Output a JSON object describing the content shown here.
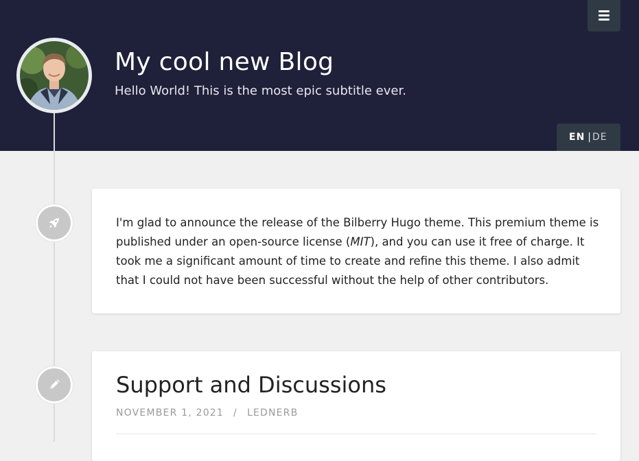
{
  "header": {
    "title": "My cool new Blog",
    "subtitle": "Hello World! This is the most epic subtitle ever.",
    "menu_icon": "hamburger-menu-icon",
    "background_color": "#1f2039"
  },
  "language_switch": {
    "current": "EN",
    "separator": "|",
    "other": "DE"
  },
  "posts": [
    {
      "icon": "rocket-icon",
      "text_before": "I'm glad to announce the release of the Bilberry Hugo theme. This premium theme is published under an open-source license (",
      "text_emphasis": "MIT",
      "text_after": "), and you can use it free of charge. It took me a significant amount of time to create and refine this theme. I also admit that I could not have been successful without the help of other contributors."
    },
    {
      "icon": "pencil-icon",
      "title": "Support and Discussions",
      "date": "NOVEMBER 1, 2021",
      "meta_separator": "/",
      "author": "LEDNERB"
    }
  ]
}
